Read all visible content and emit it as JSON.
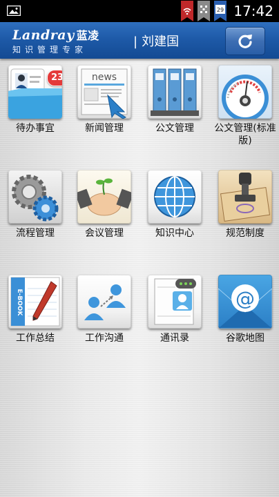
{
  "status_bar": {
    "time": "17:42",
    "notification_count": "29"
  },
  "header": {
    "logo_text": "Landray",
    "logo_cn": "蓝凌",
    "logo_subtitle": "知识管理专家",
    "separator": "|",
    "user_name": "刘建国"
  },
  "apps": [
    {
      "label": "待办事宜",
      "badge": "23"
    },
    {
      "label": "新闻管理",
      "icon_text": "news"
    },
    {
      "label": "公文管理"
    },
    {
      "label": "公文管理(标准版)"
    },
    {
      "label": "流程管理"
    },
    {
      "label": "会议管理"
    },
    {
      "label": "知识中心"
    },
    {
      "label": "规范制度"
    },
    {
      "label": "工作总结",
      "icon_text": "E-BOOK"
    },
    {
      "label": "工作沟通"
    },
    {
      "label": "通讯录"
    },
    {
      "label": "谷歌地图",
      "icon_text": "@"
    }
  ],
  "colors": {
    "header": "#1e5aa8",
    "badge": "#e43a3a"
  }
}
